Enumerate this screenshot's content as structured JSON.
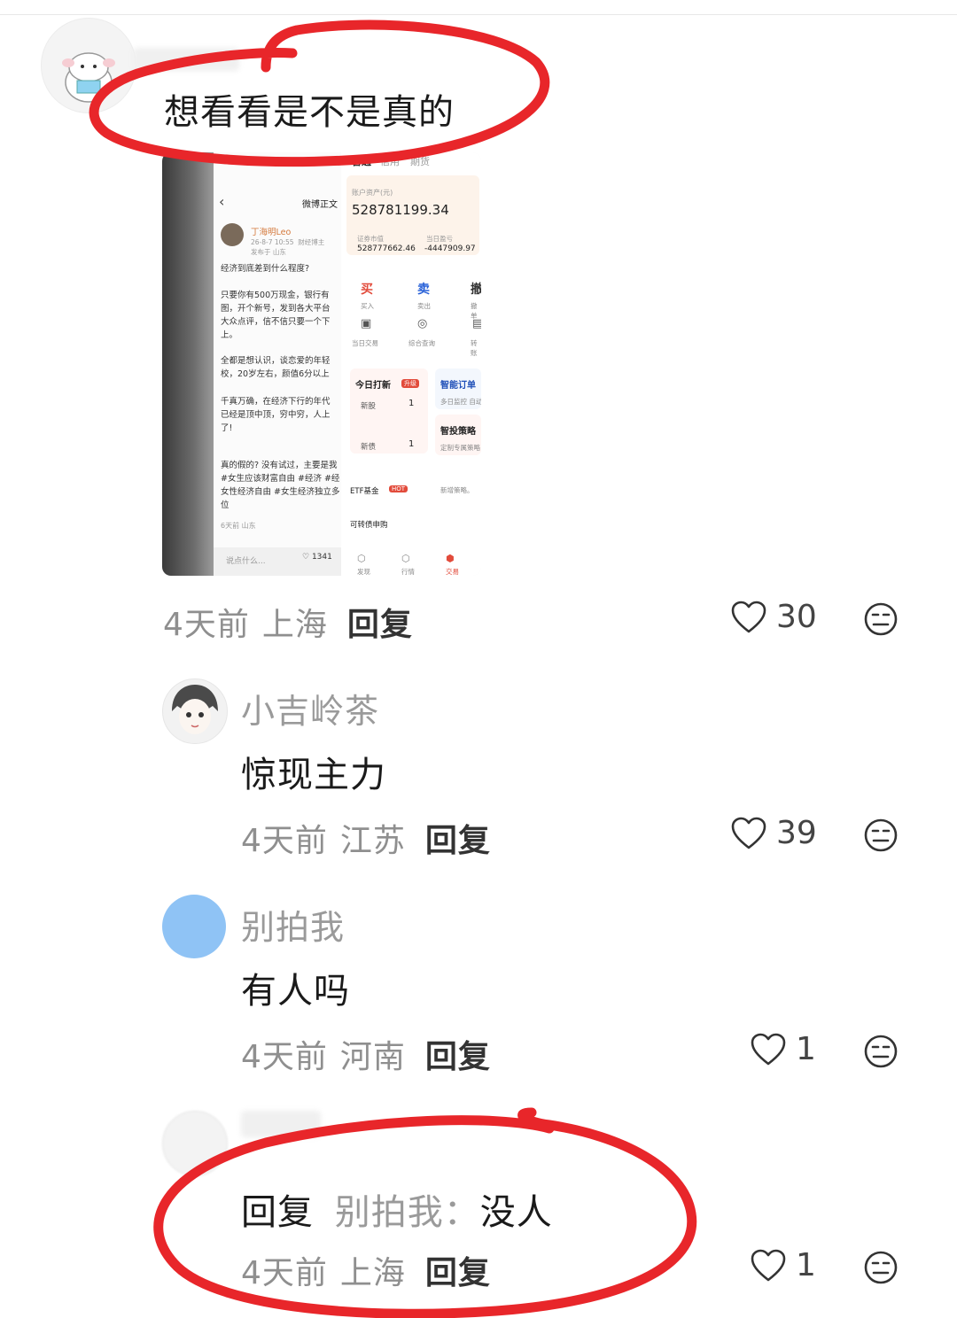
{
  "comments": [
    {
      "content": "想看看是不是真的",
      "time": "4天前",
      "location": "上海",
      "reply_label": "回复",
      "likes": "30"
    },
    {
      "name": "小吉岭茶",
      "content": "惊现主力",
      "time": "4天前",
      "location": "江苏",
      "reply_label": "回复",
      "likes": "39"
    },
    {
      "name": "别拍我",
      "content": "有人吗",
      "time": "4天前",
      "location": "河南",
      "reply_label": "回复",
      "likes": "1",
      "avatar_color": "#8fc3f5"
    },
    {
      "reply_prefix": "回复",
      "reply_to": "别拍我：",
      "content": "没人",
      "time": "4天前",
      "location": "上海",
      "reply_label": "回复",
      "likes": "1"
    }
  ],
  "screenshot": {
    "weibo": {
      "header": "微博正文",
      "user": "丁海明Leo",
      "meta": "26-8-7 10:55  财经博主\n发布于 山东",
      "p1": "经济到底差到什么程度?",
      "p2": "只要你有500万现金，银行有\n图，开个新号，发到各大平台\n大众点评，信不信只要一个下\n上。",
      "p3": "全都是想认识，谈恋爱的年轻\n校，20岁左右，颜值6分以上",
      "p4": "千真万确，在经济下行的年代\n已经是顶中顶，穷中穷，人上\n了!",
      "p5": "真的假的? 没有试过，主要是我\n#女生应该财富自由 #经济 #经\n女性经济自由 #女生经济独立多\n位",
      "p6": "6天前 山东",
      "say": "说点什么...",
      "likes": "1341"
    },
    "stock": {
      "tab1": "普通",
      "tab2": "信用",
      "tab3": "期货",
      "asset_label": "账户资产(元)",
      "asset_value": "528781199.34",
      "market_label": "证券市值",
      "market_value": "528777662.46",
      "pnl_label": "当日盈亏",
      "pnl_value": "-4447909.97",
      "buy": "买",
      "buy_sub": "买入",
      "sell": "卖",
      "sell_sub": "卖出",
      "cancel": "撤",
      "cancel_sub": "撤单",
      "today_trade": "当日交易",
      "query": "综合查询",
      "transfer": "转账",
      "ipo_title": "今日打新",
      "ipo_tag": "升级",
      "new_stock": "新股",
      "new_stock_n": "1",
      "new_bond": "新债",
      "new_bond_n": "1",
      "smart_order": "智能订单",
      "smart_sub": "多日监控 自动",
      "smart_invest": "智投策略",
      "smart_invest_sub": "定制专属策略",
      "etf": "ETF基金",
      "hot": "HOT",
      "new_strategy": "新增策略。",
      "convertible": "可转债申购",
      "nav1": "发现",
      "nav2": "行情",
      "nav3": "交易"
    }
  },
  "colors": {
    "annotation_red": "#e8262a",
    "avatar_blue": "#8fc3f5"
  }
}
